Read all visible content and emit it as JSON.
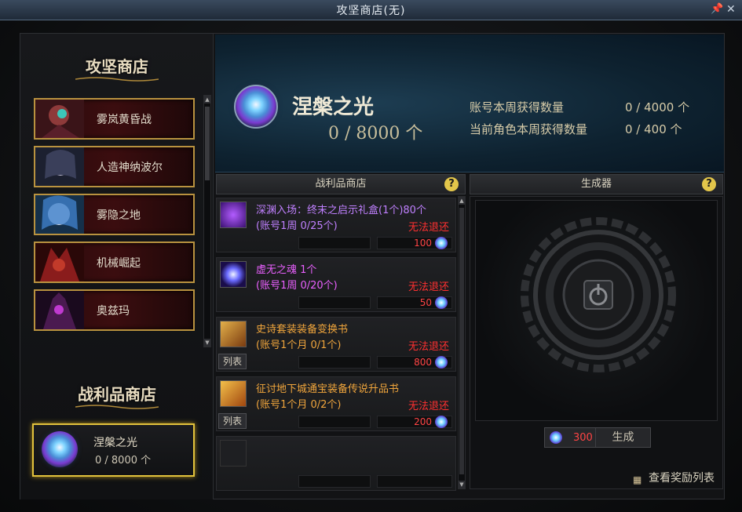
{
  "window": {
    "title": "攻坚商店(无)"
  },
  "left": {
    "title": "攻坚商店",
    "dungeons": [
      {
        "label": "雾岚黄昏战"
      },
      {
        "label": "人造神纳波尔"
      },
      {
        "label": "雾隐之地"
      },
      {
        "label": "机械崛起"
      },
      {
        "label": "奥兹玛"
      }
    ],
    "loot_title": "战利品商店",
    "currency": {
      "label": "涅槃之光",
      "count": "0 / 8000 个"
    }
  },
  "banner": {
    "name": "涅槃之光",
    "count": "0 / 8000 个",
    "stats": [
      {
        "label": "账号本周获得数量",
        "value": "0 / 4000 个"
      },
      {
        "label": "当前角色本周获得数量",
        "value": "0 /  400 个"
      }
    ]
  },
  "shop": {
    "header": "战利品商店",
    "help": "?",
    "items": [
      {
        "name": "深渊入场：终末之启示礼盒(1个)80个",
        "limit": "(账号1周 0/25个)",
        "norefund": "无法退还",
        "price": "100",
        "list_btn": ""
      },
      {
        "name": "虚无之魂 1个",
        "limit": "(账号1周 0/20个)",
        "norefund": "无法退还",
        "price": "50",
        "list_btn": ""
      },
      {
        "name": "史诗套装装备变换书",
        "limit": "(账号1个月 0/1个)",
        "norefund": "无法退还",
        "price": "800",
        "list_btn": "列表"
      },
      {
        "name": "征讨地下城通宝装备传说升品书",
        "limit": "(账号1个月 0/2个)",
        "norefund": "无法退还",
        "price": "200",
        "list_btn": "列表"
      }
    ]
  },
  "generator": {
    "header": "生成器",
    "help": "?",
    "cost": "300",
    "button": "生成",
    "rewards_link": "查看奖励列表"
  },
  "colors": {
    "accent_gold": "#e2c23c",
    "price_red": "#ff4444",
    "norefund_red": "#ff3030"
  }
}
